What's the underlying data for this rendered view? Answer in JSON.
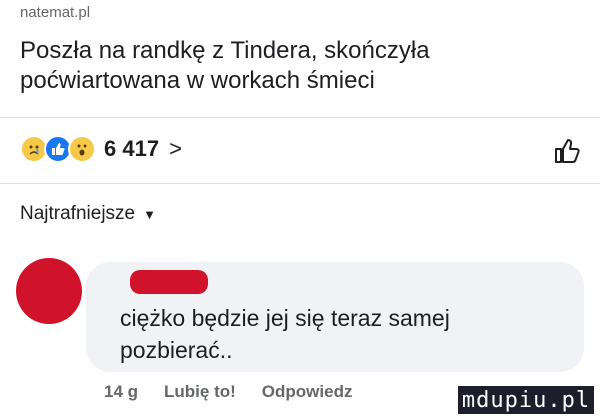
{
  "post": {
    "source": "natemat.pl",
    "headline": "Poszła na randkę z Tindera, skończyła poćwiartowana w workach śmieci"
  },
  "reactions": {
    "icons": [
      "sad-icon",
      "like-icon",
      "wow-icon"
    ],
    "count": "6 417",
    "chevron": ">"
  },
  "comments": {
    "sort_label": "Najtrafniejsze",
    "items": [
      {
        "text": "ciężko będzie jej się teraz samej pozbierać..",
        "time": "14 g",
        "like_label": "Lubię to!",
        "reply_label": "Odpowiedz"
      }
    ]
  },
  "watermark": "mdupiu.pl",
  "colors": {
    "redact": "#d0132a",
    "like_blue": "#1877f2",
    "bubble": "#f0f2f5"
  }
}
